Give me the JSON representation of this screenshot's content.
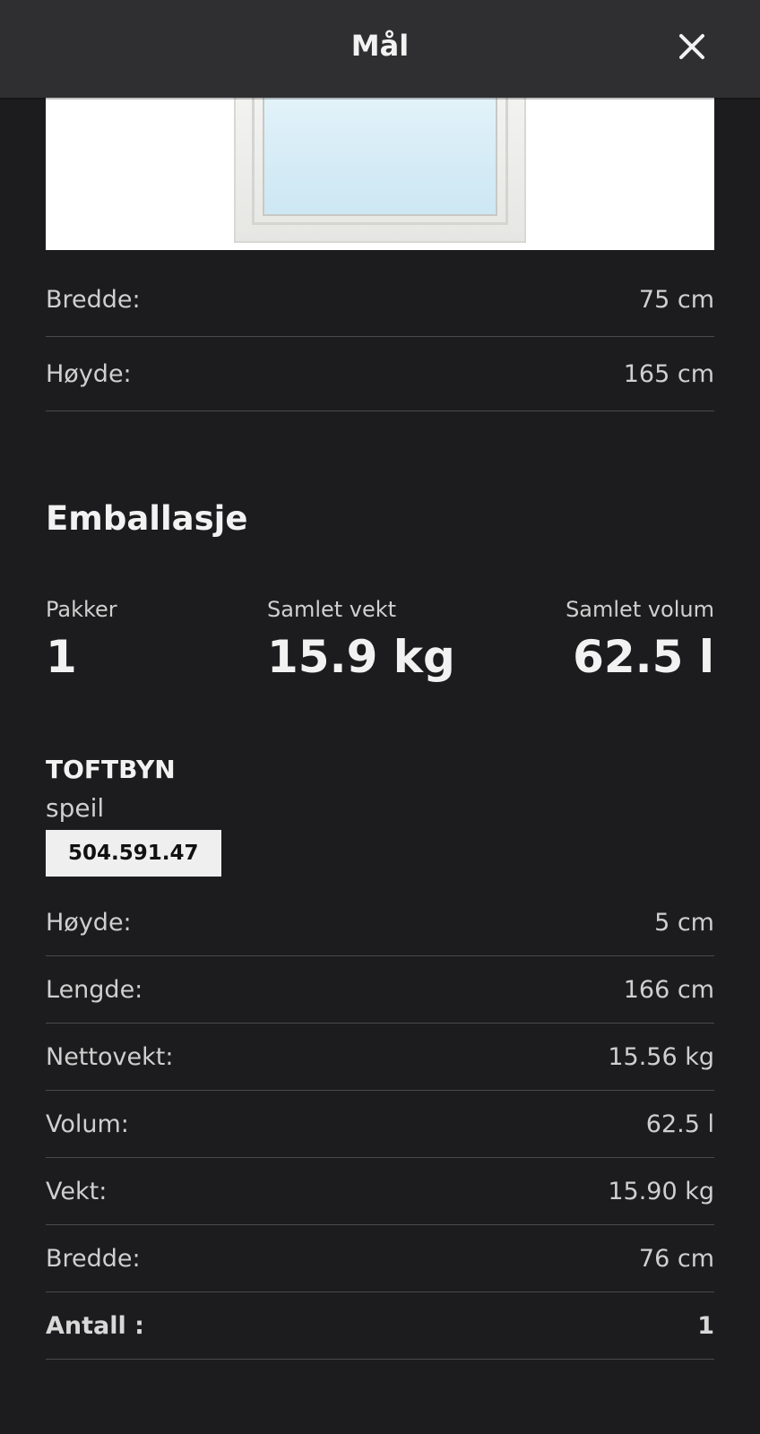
{
  "header": {
    "title": "Mål",
    "close_icon": "close-icon"
  },
  "product_image": {
    "alt": "mirror"
  },
  "dimensions": [
    {
      "label": "Bredde:",
      "value": "75 cm"
    },
    {
      "label": "Høyde:",
      "value": "165 cm"
    }
  ],
  "packaging": {
    "title": "Emballasje",
    "stats": [
      {
        "label": "Pakker",
        "value": "1"
      },
      {
        "label": "Samlet vekt",
        "value": "15.9 kg"
      },
      {
        "label": "Samlet volum",
        "value": "62.5 l"
      }
    ],
    "product": {
      "name": "TOFTBYN",
      "type": "speil",
      "article_number": "504.591.47"
    },
    "rows": [
      {
        "label": "Høyde:",
        "value": "5 cm"
      },
      {
        "label": "Lengde:",
        "value": "166 cm"
      },
      {
        "label": "Nettovekt:",
        "value": "15.56 kg"
      },
      {
        "label": "Volum:",
        "value": "62.5 l"
      },
      {
        "label": "Vekt:",
        "value": "15.90 kg"
      },
      {
        "label": "Bredde:",
        "value": "76 cm"
      },
      {
        "label": "Antall :",
        "value": "1"
      }
    ]
  }
}
